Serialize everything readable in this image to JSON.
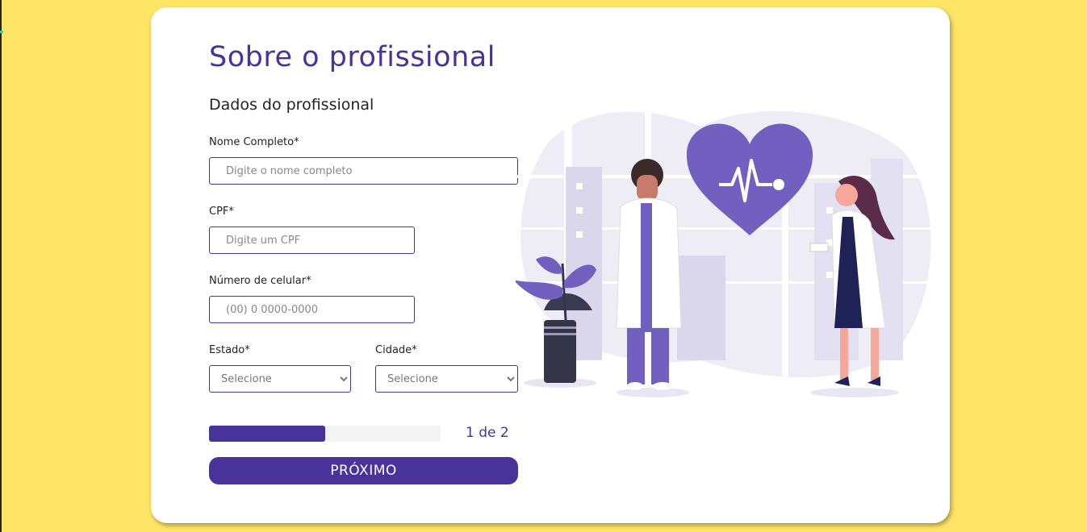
{
  "form": {
    "title": "Sobre o profissional",
    "section_title": "Dados do profissional",
    "fields": {
      "name": {
        "label": "Nome Completo*",
        "placeholder": "Digite o nome completo"
      },
      "cpf": {
        "label": "CPF*",
        "placeholder": "Digite um CPF"
      },
      "phone": {
        "label": "Número de celular*",
        "placeholder": "(00) 0 0000-0000"
      },
      "state": {
        "label": "Estado*",
        "selected": "Selecione"
      },
      "city": {
        "label": "Cidade*",
        "selected": "Selecione"
      }
    },
    "progress": {
      "text": "1 de 2",
      "fraction": 0.5
    },
    "next_button": "PRÓXIMO"
  },
  "colors": {
    "background": "#FFE566",
    "accent": "#473399",
    "illustration_purple": "#7260C0",
    "illustration_light": "#EEEDF6"
  },
  "illustration": {
    "icons": [
      "heart-pulse-icon",
      "plant-icon",
      "male-doctor-figure",
      "female-doctor-figure",
      "city-buildings-backdrop"
    ]
  }
}
